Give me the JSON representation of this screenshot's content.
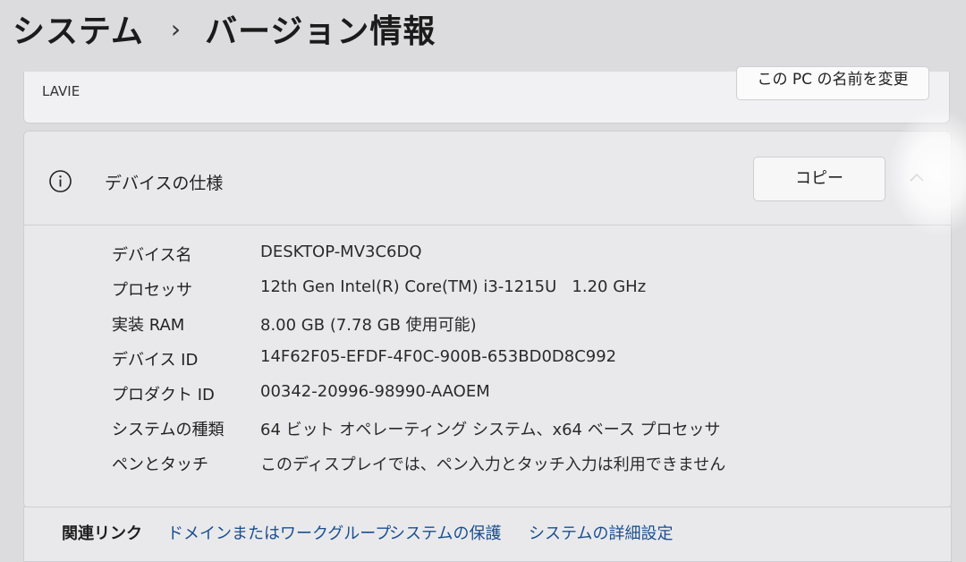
{
  "breadcrumb": {
    "parent": "システム",
    "separator": "›",
    "current": "バージョン情報"
  },
  "device_card": {
    "subtitle": "LAVIE",
    "rename_button": "この PC の名前を変更"
  },
  "spec_card": {
    "icon": "info-icon",
    "title": "デバイスの仕様",
    "copy_button": "コピー",
    "expand_icon": "chevron-up-icon",
    "rows": [
      {
        "label": "デバイス名",
        "value": "DESKTOP-MV3C6DQ"
      },
      {
        "label": "プロセッサ",
        "value": "12th Gen Intel(R) Core(TM) i3-1215U   1.20 GHz"
      },
      {
        "label": "実装 RAM",
        "value": "8.00 GB (7.78 GB 使用可能)"
      },
      {
        "label": "デバイス ID",
        "value": "14F62F05-EFDF-4F0C-900B-653BD0D8C992"
      },
      {
        "label": "プロダクト ID",
        "value": "00342-20996-98990-AAOEM"
      },
      {
        "label": "システムの種類",
        "value": "64 ビット オペレーティング システム、x64 ベース プロセッサ"
      },
      {
        "label": "ペンとタッチ",
        "value": "このディスプレイでは、ペン入力とタッチ入力は利用できません"
      }
    ]
  },
  "related_links": {
    "label": "関連リンク",
    "links": [
      "ドメインまたはワークグループ",
      "システムの保護",
      "システムの詳細設定"
    ]
  },
  "colors": {
    "background": "#dcdcde",
    "card": "#e9e9ec",
    "link": "#1a4f8f"
  }
}
